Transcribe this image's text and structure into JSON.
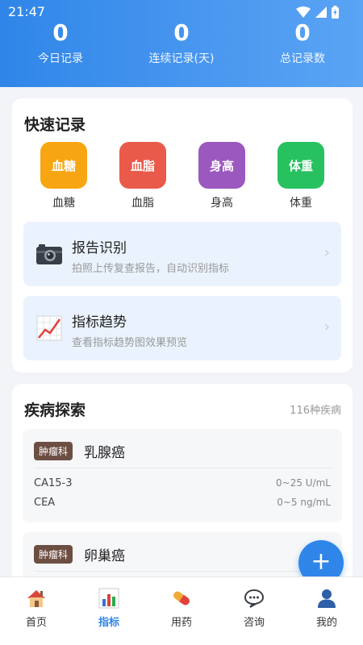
{
  "status": {
    "time": "21:47"
  },
  "stats": [
    {
      "value": "0",
      "label": "今日记录"
    },
    {
      "value": "0",
      "label": "连续记录(天)"
    },
    {
      "value": "0",
      "label": "总记录数"
    }
  ],
  "quick": {
    "title": "快速记录",
    "items": [
      {
        "icon_text": "血糖",
        "label": "血糖",
        "color": "#f7a611"
      },
      {
        "icon_text": "血脂",
        "label": "血脂",
        "color": "#ea5a4b"
      },
      {
        "icon_text": "身高",
        "label": "身高",
        "color": "#9b59c0"
      },
      {
        "icon_text": "体重",
        "label": "体重",
        "color": "#27c160"
      }
    ],
    "features": [
      {
        "icon": "camera-icon",
        "title": "报告识别",
        "subtitle": "拍照上传复查报告，自动识别指标"
      },
      {
        "icon": "trend-chart-icon",
        "title": "指标趋势",
        "subtitle": "查看指标趋势图效果预览"
      }
    ]
  },
  "disease": {
    "title": "疾病探索",
    "count": "116种疾病",
    "items": [
      {
        "dept": "肿瘤科",
        "name": "乳腺癌",
        "indicators": [
          {
            "name": "CA15-3",
            "range": "0~25 U/mL"
          },
          {
            "name": "CEA",
            "range": "0~5 ng/mL"
          }
        ]
      },
      {
        "dept": "肿瘤科",
        "name": "卵巢癌"
      }
    ]
  },
  "fab": {
    "label": "+"
  },
  "tabs": [
    {
      "label": "首页",
      "icon": "home-icon"
    },
    {
      "label": "指标",
      "icon": "bar-chart-icon",
      "active": true
    },
    {
      "label": "用药",
      "icon": "pill-icon"
    },
    {
      "label": "咨询",
      "icon": "chat-icon"
    },
    {
      "label": "我的",
      "icon": "user-icon"
    }
  ],
  "colors": {
    "primary": "#2f86e8",
    "dept_badge": "#6d4e43"
  }
}
